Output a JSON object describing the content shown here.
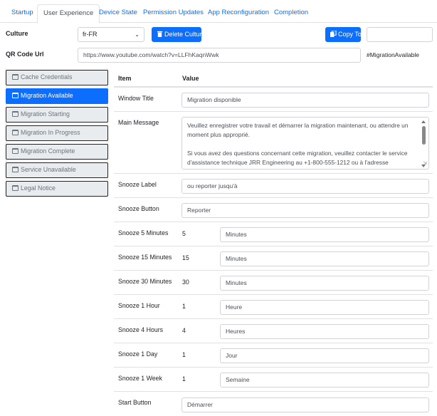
{
  "tabs": [
    {
      "label": "Startup"
    },
    {
      "label": "User Experience"
    },
    {
      "label": "Device State"
    },
    {
      "label": "Permission Updates"
    },
    {
      "label": "App Reconfiguration"
    },
    {
      "label": "Completion"
    }
  ],
  "culture": {
    "label": "Culture",
    "selected": "fr-FR",
    "delete_label": "Delete Culture",
    "copy_label": "Copy To",
    "copy_target_value": ""
  },
  "qr": {
    "label": "QR Code Url",
    "value": "https://www.youtube.com/watch?v=LLFhKaqnWwk",
    "hashtag": "#MigrationAvailable"
  },
  "sidebar": {
    "items": [
      {
        "label": "Cache Credentials"
      },
      {
        "label": "Migration Available"
      },
      {
        "label": "Migration Starting"
      },
      {
        "label": "Migration In Progress"
      },
      {
        "label": "Migration Complete"
      },
      {
        "label": "Service Unavailable"
      },
      {
        "label": "Legal Notice"
      }
    ]
  },
  "table": {
    "col_item": "Item",
    "col_value": "Value",
    "window_title": {
      "label": "Window Title",
      "value": "Migration disponible"
    },
    "main_message": {
      "label": "Main Message",
      "para1": "Veuillez enregistrer votre travail et démarrer la migration maintenant, ou attendre un moment plus approprié.",
      "para2": "Si vous avez des questions concernant cette migration, veuillez contacter le service d'assistance technique JRR Engineering au +1-800-555-1212 ou à l'adresse"
    },
    "snooze_label": {
      "label": "Snooze Label",
      "value": "ou reporter jusqu'à"
    },
    "snooze_button": {
      "label": "Snooze Button",
      "value": "Reporter"
    },
    "snooze_rows": [
      {
        "label": "Snooze 5 Minutes",
        "num": "5",
        "unit": "Minutes"
      },
      {
        "label": "Snooze 15 Minutes",
        "num": "15",
        "unit": "Minutes"
      },
      {
        "label": "Snooze 30 Minutes",
        "num": "30",
        "unit": "Minutes"
      },
      {
        "label": "Snooze 1 Hour",
        "num": "1",
        "unit": "Heure"
      },
      {
        "label": "Snooze 4 Hours",
        "num": "4",
        "unit": "Heures"
      },
      {
        "label": "Snooze 1 Day",
        "num": "1",
        "unit": "Jour"
      },
      {
        "label": "Snooze 1 Week",
        "num": "1",
        "unit": "Semaine"
      }
    ],
    "start_button": {
      "label": "Start Button",
      "value": "Démarrer"
    }
  },
  "colors": {
    "primary": "#0d6efd",
    "border": "#dee2e6"
  }
}
